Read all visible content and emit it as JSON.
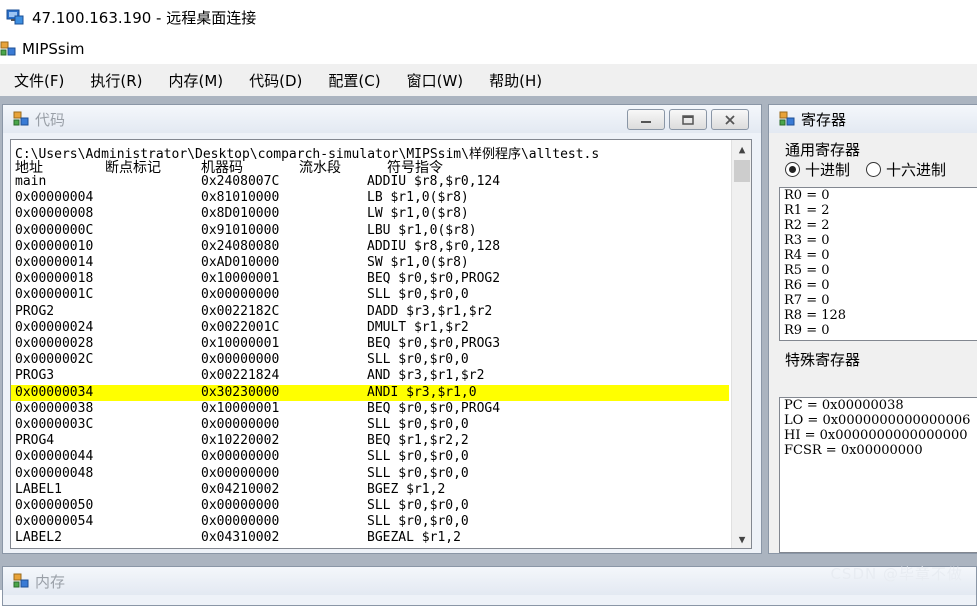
{
  "rdp": {
    "title": "47.100.163.190 - 远程桌面连接"
  },
  "app": {
    "title": "MIPSsim"
  },
  "menu": [
    "文件(F)",
    "执行(R)",
    "内存(M)",
    "代码(D)",
    "配置(C)",
    "窗口(W)",
    "帮助(H)"
  ],
  "code_window": {
    "title": "代码",
    "path": "C:\\Users\\Administrator\\Desktop\\comparch-simulator\\MIPSsim\\样例程序\\alltest.s",
    "headers": [
      "地址",
      "断点标记",
      "机器码",
      "流水段",
      "符号指令"
    ],
    "rows": [
      [
        "main",
        "0x2408007C",
        "ADDIU $r8,$r0,124"
      ],
      [
        "0x00000004",
        "0x81010000",
        "LB $r1,0($r8)"
      ],
      [
        "0x00000008",
        "0x8D010000",
        "LW $r1,0($r8)"
      ],
      [
        "0x0000000C",
        "0x91010000",
        "LBU $r1,0($r8)"
      ],
      [
        "0x00000010",
        "0x24080080",
        "ADDIU $r8,$r0,128"
      ],
      [
        "0x00000014",
        "0xAD010000",
        "SW $r1,0($r8)"
      ],
      [
        "0x00000018",
        "0x10000001",
        "BEQ $r0,$r0,PROG2"
      ],
      [
        "0x0000001C",
        "0x00000000",
        "SLL $r0,$r0,0"
      ],
      [
        "PROG2",
        "0x0022182C",
        "DADD $r3,$r1,$r2"
      ],
      [
        "0x00000024",
        "0x0022001C",
        "DMULT $r1,$r2"
      ],
      [
        "0x00000028",
        "0x10000001",
        "BEQ $r0,$r0,PROG3"
      ],
      [
        "0x0000002C",
        "0x00000000",
        "SLL $r0,$r0,0"
      ],
      [
        "PROG3",
        "0x00221824",
        "AND $r3,$r1,$r2"
      ],
      [
        "0x00000034",
        "0x30230000",
        "ANDI $r3,$r1,0"
      ],
      [
        "0x00000038",
        "0x10000001",
        "BEQ $r0,$r0,PROG4"
      ],
      [
        "0x0000003C",
        "0x00000000",
        "SLL $r0,$r0,0"
      ],
      [
        "PROG4",
        "0x10220002",
        "BEQ $r1,$r2,2"
      ],
      [
        "0x00000044",
        "0x00000000",
        "SLL $r0,$r0,0"
      ],
      [
        "0x00000048",
        "0x00000000",
        "SLL $r0,$r0,0"
      ],
      [
        "LABEL1",
        "0x04210002",
        "BGEZ $r1,2"
      ],
      [
        "0x00000050",
        "0x00000000",
        "SLL $r0,$r0,0"
      ],
      [
        "0x00000054",
        "0x00000000",
        "SLL $r0,$r0,0"
      ],
      [
        "LABEL2",
        "0x04310002",
        "BGEZAL $r1,2"
      ]
    ],
    "highlight_index": 13,
    "highlight_color": "#ffff00"
  },
  "reg_window": {
    "title": "寄存器",
    "general_label": "通用寄存器",
    "decimal_label": "十进制",
    "hex_label": "十六进制",
    "general": [
      "R0 = 0",
      "R1 = 2",
      "R2 = 2",
      "R3 = 0",
      "R4 = 0",
      "R5 = 0",
      "R6 = 0",
      "R7 = 0",
      "R8 = 128",
      "R9 = 0"
    ],
    "special_label": "特殊寄存器",
    "special": [
      "PC = 0x00000038",
      "LO = 0x0000000000000006",
      "HI = 0x0000000000000000",
      "FCSR = 0x00000000"
    ]
  },
  "mem_window": {
    "title": "内存"
  },
  "watermark": "CSDN @毕章不做"
}
